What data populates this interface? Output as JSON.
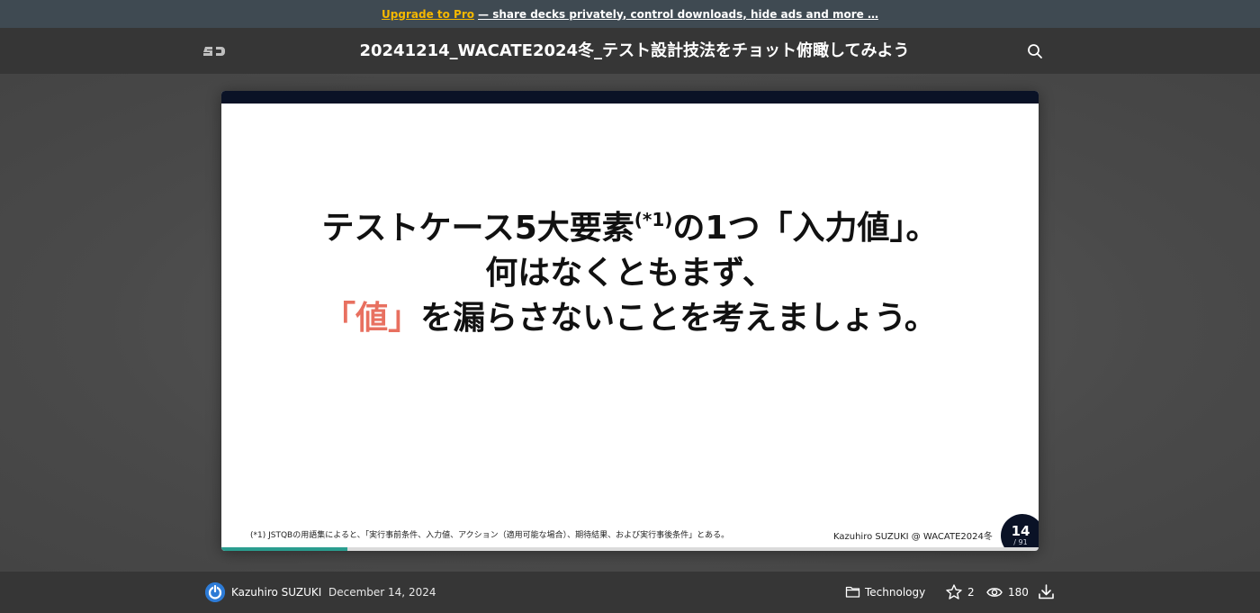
{
  "promo": {
    "pro_link": "Upgrade to Pro",
    "rest": "— share decks privately, control downloads, hide ads and more …"
  },
  "header": {
    "logo_text": "SD",
    "title": "20241214_WACATE2024冬_テスト設計技法をチョット俯瞰してみよう",
    "search_icon": "search-icon"
  },
  "slide": {
    "line1_main": "テストケース5大要素",
    "line1_sup": "(*1)",
    "line1_tail": "の1つ「入力値」。",
    "line2": "何はなくともまず、",
    "line3_accent": "「値」",
    "line3_rest": "を漏らさないことを考えましょう。",
    "footnote": "(*1) JSTQBの用語集によると、「実行事前条件、入力値、アクション（適用可能な場合）、期待結果、および実行事後条件」とある。",
    "credit": "Kazuhiro SUZUKI @ WACATE2024冬",
    "page_current": "14",
    "page_total": "/ 91",
    "progress_fraction": 0.1538,
    "accent_color": "#e87060"
  },
  "footer": {
    "author": "Kazuhiro SUZUKI",
    "date": "December 14, 2024",
    "category": "Technology",
    "stars": "2",
    "views": "180"
  }
}
